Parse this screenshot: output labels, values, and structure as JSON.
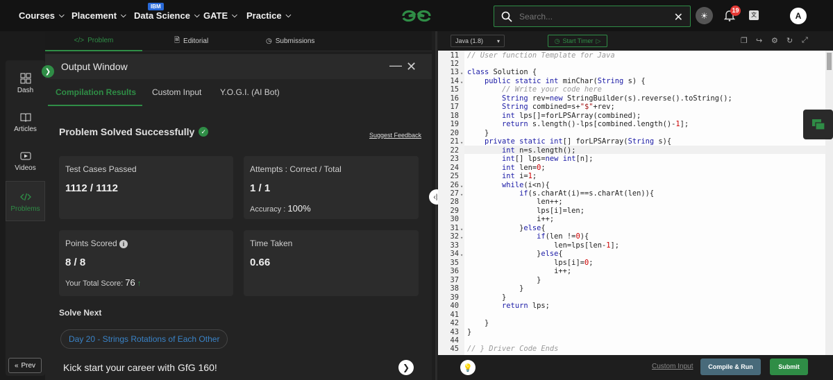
{
  "nav": {
    "items": [
      {
        "label": "Courses"
      },
      {
        "label": "Placement"
      },
      {
        "label": "Data Science"
      },
      {
        "label": "GATE"
      },
      {
        "label": "Practice"
      }
    ],
    "ibm_badge": "IBM",
    "search_placeholder": "Search...",
    "notif_count": "19",
    "avatar_initial": "A"
  },
  "sidebar": {
    "items": [
      {
        "label": "Dash"
      },
      {
        "label": "Articles"
      },
      {
        "label": "Videos"
      },
      {
        "label": "Problems"
      }
    ],
    "prev_label": "Prev"
  },
  "problem_tabs": [
    {
      "label": "Problem"
    },
    {
      "label": "Editorial"
    },
    {
      "label": "Submissions"
    }
  ],
  "output": {
    "title": "Output Window",
    "tabs": [
      {
        "label": "Compilation Results"
      },
      {
        "label": "Custom Input"
      },
      {
        "label": "Y.O.G.I. (AI Bot)"
      }
    ],
    "status": "Problem Solved Successfully",
    "feedback": "Suggest Feedback",
    "test_cases_label": "Test Cases Passed",
    "test_cases_value": "1112 / 1112",
    "attempts_label": "Attempts : Correct / Total",
    "attempts_value": "1 / 1",
    "accuracy_label": "Accuracy :",
    "accuracy_value": "100%",
    "points_label": "Points Scored",
    "points_value": "8 / 8",
    "total_score_label": "Your Total Score:",
    "total_score_value": "76",
    "time_label": "Time Taken",
    "time_value": "0.66",
    "solve_next_label": "Solve Next",
    "next_problem": "Day 20 - Strings Rotations of Each Other",
    "kick_start": "Kick start your career with GfG 160!"
  },
  "editor": {
    "language": "Java (1.8)",
    "timer_label": "Start Timer",
    "custom_input": "Custom Input",
    "compile_label": "Compile & Run",
    "submit_label": "Submit",
    "lines": [
      {
        "n": "11",
        "text": "// User function Template for Java"
      },
      {
        "n": "12",
        "text": ""
      },
      {
        "n": "13",
        "text": "class Solution {"
      },
      {
        "n": "14",
        "text": "    public static int minChar(String s) {"
      },
      {
        "n": "15",
        "text": "        // Write your code here"
      },
      {
        "n": "16",
        "text": "        String rev=new StringBuilder(s).reverse().toString();"
      },
      {
        "n": "17",
        "text": "        String combined=s+\"$\"+rev;"
      },
      {
        "n": "18",
        "text": "        int lps[]=forLPSArray(combined);"
      },
      {
        "n": "19",
        "text": "        return s.length()-lps[combined.length()-1];"
      },
      {
        "n": "20",
        "text": "    }"
      },
      {
        "n": "21",
        "text": "    private static int[] forLPSArray(String s){"
      },
      {
        "n": "22",
        "text": "        int n=s.length();"
      },
      {
        "n": "23",
        "text": "        int[] lps=new int[n];"
      },
      {
        "n": "24",
        "text": "        int len=0;"
      },
      {
        "n": "25",
        "text": "        int i=1;"
      },
      {
        "n": "26",
        "text": "        while(i<n){"
      },
      {
        "n": "27",
        "text": "            if(s.charAt(i)==s.charAt(len)){"
      },
      {
        "n": "28",
        "text": "                len++;"
      },
      {
        "n": "29",
        "text": "                lps[i]=len;"
      },
      {
        "n": "30",
        "text": "                i++;"
      },
      {
        "n": "31",
        "text": "            }else{"
      },
      {
        "n": "32",
        "text": "                if(len !=0){"
      },
      {
        "n": "33",
        "text": "                    len=lps[len-1];"
      },
      {
        "n": "34",
        "text": "                }else{"
      },
      {
        "n": "35",
        "text": "                    lps[i]=0;"
      },
      {
        "n": "36",
        "text": "                    i++;"
      },
      {
        "n": "37",
        "text": "                }"
      },
      {
        "n": "38",
        "text": "            }"
      },
      {
        "n": "39",
        "text": "        }"
      },
      {
        "n": "40",
        "text": "        return lps;"
      },
      {
        "n": "41",
        "text": ""
      },
      {
        "n": "42",
        "text": "    }"
      },
      {
        "n": "43",
        "text": "}"
      },
      {
        "n": "44",
        "text": ""
      },
      {
        "n": "45",
        "text": "// } Driver Code Ends"
      }
    ]
  },
  "colors": {
    "brand_green": "#2f8d46",
    "link_blue": "#3a83c7",
    "compile_bg": "#486a7a"
  }
}
